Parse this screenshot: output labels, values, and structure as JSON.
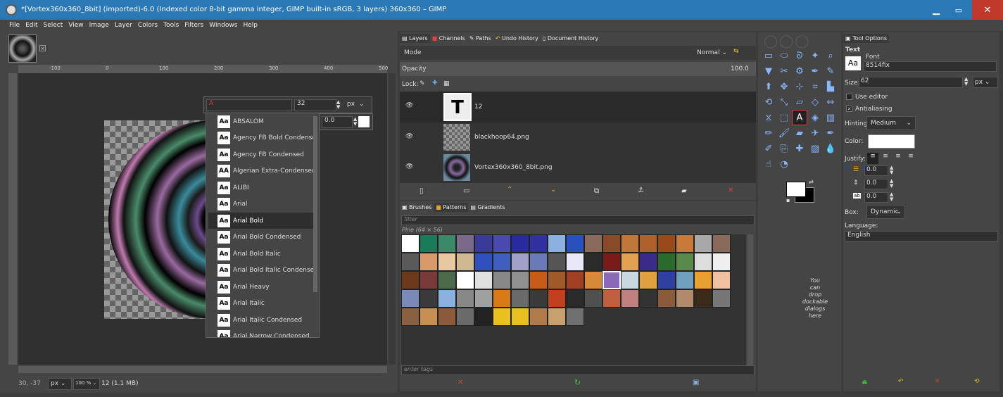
{
  "window": {
    "title": "*[Vortex360x360_8bit] (imported)-6.0 (Indexed color 8-bit gamma integer, GIMP built-in sRGB, 3 layers) 360x360 – GIMP",
    "minimize": "▁",
    "maximize": "▭",
    "close": "✕"
  },
  "menu": [
    "File",
    "Edit",
    "Select",
    "View",
    "Image",
    "Layer",
    "Colors",
    "Tools",
    "Filters",
    "Windows",
    "Help"
  ],
  "ruler_top": [
    "-100",
    "0",
    "100",
    "200",
    "300",
    "400",
    "500"
  ],
  "ruler_left": [
    "1",
    "0",
    "0",
    "2",
    "0",
    "0",
    "3",
    "0",
    "0",
    "4"
  ],
  "status": {
    "coords": "30, -37",
    "unit": "px",
    "zoom": "100 %",
    "info": "12 (1.1 MB)"
  },
  "text_overlay": {
    "font_field": "A",
    "size": "32",
    "unit": "px",
    "baseline": "0.0"
  },
  "font_list": [
    {
      "name": "ABSALOM",
      "glyph": "Aa"
    },
    {
      "name": "Agency FB Bold Condensed",
      "glyph": "Aa"
    },
    {
      "name": "Agency FB Condensed",
      "glyph": "Aa"
    },
    {
      "name": "Algerian Extra-Condensed",
      "glyph": "AA"
    },
    {
      "name": "ALIBI",
      "glyph": "Aa"
    },
    {
      "name": "Arial",
      "glyph": "Aa"
    },
    {
      "name": "Arial Bold",
      "glyph": "Aa"
    },
    {
      "name": "Arial Bold Condensed",
      "glyph": "Aa"
    },
    {
      "name": "Arial Bold Italic",
      "glyph": "Aa"
    },
    {
      "name": "Arial Bold Italic Condensed",
      "glyph": "Aa"
    },
    {
      "name": "Arial Heavy",
      "glyph": "Aa"
    },
    {
      "name": "Arial Italic",
      "glyph": "Aa"
    },
    {
      "name": "Arial Italic Condensed",
      "glyph": "Aa"
    },
    {
      "name": "Arial Narrow Condensed",
      "glyph": "Aa"
    }
  ],
  "font_selected": "Arial Bold",
  "layers_panel": {
    "tabs": [
      "Layers",
      "Channels",
      "Paths",
      "Undo History",
      "Document History"
    ],
    "mode_label": "Mode",
    "mode_value": "Normal",
    "opacity_label": "Opacity",
    "opacity_value": "100.0",
    "lock_label": "Lock:",
    "layers": [
      {
        "name": "12",
        "thumb": "text"
      },
      {
        "name": "blackhoop64.png",
        "thumb": "check"
      },
      {
        "name": "Vortex360x360_8bit.png",
        "thumb": "vortex"
      }
    ]
  },
  "patterns_panel": {
    "tabs": [
      "Brushes",
      "Patterns",
      "Gradients"
    ],
    "filter_placeholder": "filter",
    "pattern_name": "Pine (64 × 56)",
    "tags_placeholder": "enter tags",
    "swatches": [
      "#ffffff",
      "#1b7a5a",
      "#3a8a6a",
      "#7a6a8a",
      "#3a3a9a",
      "#4a4ab0",
      "#2a2aa0",
      "#3030a0",
      "#8ab0e0",
      "#2a50c0",
      "#8a6a5a",
      "#8a4a2a",
      "#c0783a",
      "#b0602a",
      "#9a4a1a",
      "#c87a3a",
      "#a8a8a8",
      "#8a6a5a",
      "#5a5a5a",
      "#d89a6a",
      "#e8c8a0",
      "#d0b890",
      "#3050c0",
      "#4060c0",
      "#a0a0c8",
      "#6a7ab8",
      "#555555",
      "#e8e8f8",
      "#2a2a2a",
      "#7a1a1a",
      "#e0a050",
      "#3a2a8a",
      "#2a6a2a",
      "#5a8a4a",
      "#dddddd",
      "#f0f0f0",
      "#6a3a1a",
      "#7a3a3a",
      "#4a6a4a",
      "#ffffff",
      "#e0e0e0",
      "#888888",
      "#909090",
      "#c85a1a",
      "#a05a2a",
      "#a04020",
      "#d88a3a",
      "#8a6ab8",
      "#c8d8e0",
      "#e0a040",
      "#3040a0",
      "#70a0c0",
      "#e8a030",
      "#f0c0a0",
      "#7a8ab8",
      "#3a3a3a",
      "#8ab0e0",
      "#888888",
      "#a0a0a0",
      "#d87a1a",
      "#6a6a6a",
      "#3a3a3a",
      "#c04020",
      "#2a2a2a",
      "#505050",
      "#c06040",
      "#c08080",
      "#333333",
      "#8a5a3a",
      "#b08a6a",
      "#3a2a1a",
      "#777777",
      "#8a6040",
      "#c89050",
      "#8a5a3a",
      "#6a6a6a",
      "#222222",
      "#e8c020",
      "#e8c020",
      "#b07a4a",
      "#c8a070",
      "#707070"
    ],
    "selected_index": 47
  },
  "dock_hint": [
    "You",
    "can",
    "drop",
    "dockable",
    "dialogs",
    "here"
  ],
  "toolbox": {
    "logo": "gimp"
  },
  "tool_options": {
    "tab": "Tool Options",
    "title": "Text",
    "font_label": "Font",
    "font_preview": "Aa",
    "font_value": "8514fix",
    "size_label": "Size:",
    "size_value": "62",
    "size_unit": "px",
    "use_editor": "Use editor",
    "antialiasing": "Antialiasing",
    "hinting_label": "Hinting:",
    "hinting_value": "Medium",
    "color_label": "Color:",
    "justify_label": "Justify:",
    "indent_value": "0.0",
    "line_spacing_value": "0.0",
    "letter_spacing_value": "0.0",
    "box_label": "Box:",
    "box_value": "Dynamic",
    "language_label": "Language:",
    "language_value": "English"
  },
  "colors": {
    "titlebar": "#2b78b7",
    "accent": "#e8a030",
    "close_red": "#c0392b"
  }
}
